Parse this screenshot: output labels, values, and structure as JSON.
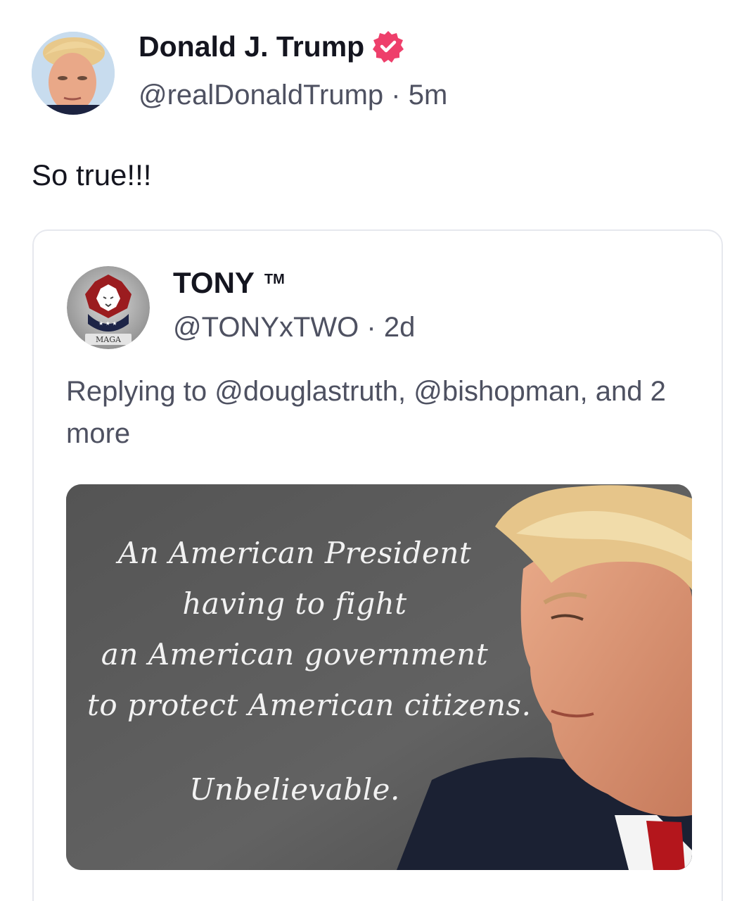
{
  "post": {
    "display_name": "Donald J. Trump",
    "handle": "@realDonaldTrump",
    "separator": "·",
    "time": "5m",
    "text": "So true!!!",
    "verified_color": "#ee3f6b"
  },
  "quote": {
    "display_name": "TONY",
    "tm": "TM",
    "handle": "@TONYxTWO",
    "separator": "·",
    "time": "2d",
    "reply_text": "Replying to @douglastruth, @bishopman, and 2 more",
    "avatar_label": "MAGA"
  },
  "meme": {
    "lines": [
      "An American President",
      "having to fight",
      "an American government",
      "to protect American citizens."
    ],
    "closing": "Unbelievable."
  },
  "colors": {
    "text_primary": "#14151f",
    "text_secondary": "#4e5161",
    "card_border": "#e6e8ee",
    "meme_bg": "#5a5a5a"
  }
}
